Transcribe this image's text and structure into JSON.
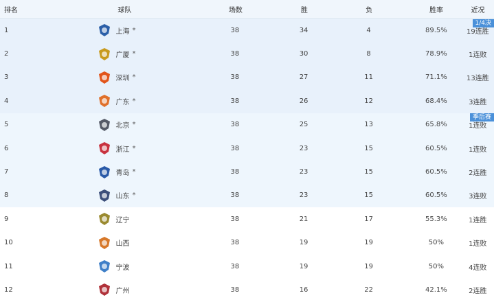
{
  "headers": {
    "rank": "排名",
    "team": "球队",
    "games": "场数",
    "win": "胜",
    "loss": "负",
    "rate": "胜率",
    "streak": "近况"
  },
  "tags": {
    "playoff_top": "1/4决",
    "playoff": "季后赛"
  },
  "rows": [
    {
      "rank": "1",
      "team": "上海",
      "mark": "*",
      "games": "38",
      "win": "34",
      "loss": "4",
      "rate": "89.5%",
      "streak": "19连胜",
      "logo_color": "#2b5fa8"
    },
    {
      "rank": "2",
      "team": "广厦",
      "mark": "*",
      "games": "38",
      "win": "30",
      "loss": "8",
      "rate": "78.9%",
      "streak": "1连败",
      "logo_color": "#c89a1c"
    },
    {
      "rank": "3",
      "team": "深圳",
      "mark": "*",
      "games": "38",
      "win": "27",
      "loss": "11",
      "rate": "71.1%",
      "streak": "13连胜",
      "logo_color": "#e2551b"
    },
    {
      "rank": "4",
      "team": "广东",
      "mark": "*",
      "games": "38",
      "win": "26",
      "loss": "12",
      "rate": "68.4%",
      "streak": "3连胜",
      "logo_color": "#e0702b"
    },
    {
      "rank": "5",
      "team": "北京",
      "mark": "*",
      "games": "38",
      "win": "25",
      "loss": "13",
      "rate": "65.8%",
      "streak": "1连败",
      "logo_color": "#555a66"
    },
    {
      "rank": "6",
      "team": "浙江",
      "mark": "*",
      "games": "38",
      "win": "23",
      "loss": "15",
      "rate": "60.5%",
      "streak": "1连败",
      "logo_color": "#c8323f"
    },
    {
      "rank": "7",
      "team": "青岛",
      "mark": "*",
      "games": "38",
      "win": "23",
      "loss": "15",
      "rate": "60.5%",
      "streak": "2连胜",
      "logo_color": "#2a5aa8"
    },
    {
      "rank": "8",
      "team": "山东",
      "mark": "*",
      "games": "38",
      "win": "23",
      "loss": "15",
      "rate": "60.5%",
      "streak": "3连败",
      "logo_color": "#3c4e7a"
    },
    {
      "rank": "9",
      "team": "辽宁",
      "mark": "",
      "games": "38",
      "win": "21",
      "loss": "17",
      "rate": "55.3%",
      "streak": "1连胜",
      "logo_color": "#9a8a30"
    },
    {
      "rank": "10",
      "team": "山西",
      "mark": "",
      "games": "38",
      "win": "19",
      "loss": "19",
      "rate": "50%",
      "streak": "1连败",
      "logo_color": "#d7782a"
    },
    {
      "rank": "11",
      "team": "宁波",
      "mark": "",
      "games": "38",
      "win": "19",
      "loss": "19",
      "rate": "50%",
      "streak": "4连败",
      "logo_color": "#3f7fc8"
    },
    {
      "rank": "12",
      "team": "广州",
      "mark": "",
      "games": "38",
      "win": "16",
      "loss": "22",
      "rate": "42.1%",
      "streak": "2连胜",
      "logo_color": "#b0323a"
    }
  ]
}
